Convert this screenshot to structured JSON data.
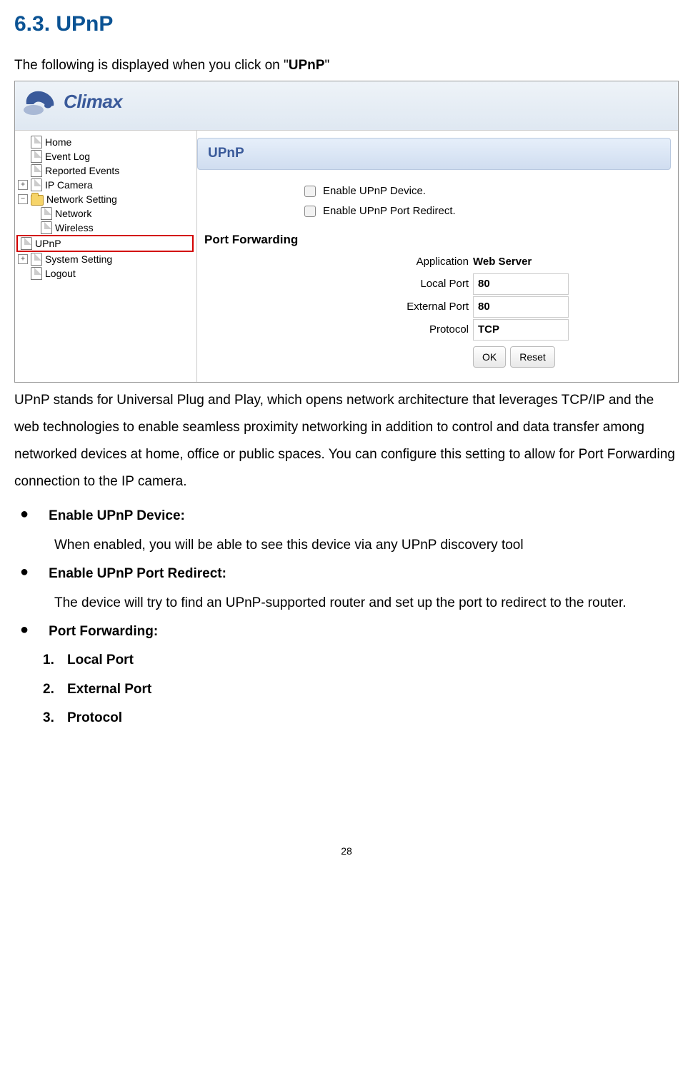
{
  "heading": "6.3. UPnP",
  "intro_prefix": "The following is displayed when you click on \"",
  "intro_bold": "UPnP",
  "intro_suffix": "\"",
  "screenshot": {
    "logo_text": "Climax",
    "tree": {
      "home": "Home",
      "event_log": "Event Log",
      "reported_events": "Reported Events",
      "ip_camera": "IP Camera",
      "network_setting": "Network Setting",
      "network": "Network",
      "wireless": "Wireless",
      "upnp": "UPnP",
      "system_setting": "System Setting",
      "logout": "Logout"
    },
    "panel_title": "UPnP",
    "checkbox1": "Enable UPnP Device.",
    "checkbox2": "Enable UPnP Port Redirect.",
    "port_forwarding_title": "Port Forwarding",
    "application_label": "Application",
    "application_value": "Web Server",
    "local_port_label": "Local Port",
    "local_port_value": "80",
    "external_port_label": "External Port",
    "external_port_value": "80",
    "protocol_label": "Protocol",
    "protocol_value": "TCP",
    "ok_button": "OK",
    "reset_button": "Reset"
  },
  "paragraph": "UPnP stands for Universal Plug and Play, which opens network architecture that leverages TCP/IP and the web technologies to enable seamless proximity networking in addition to control and data transfer among networked devices at home, office or public spaces. You can configure this setting to allow for Port Forwarding connection to the IP camera.",
  "bullets": [
    {
      "title": "Enable UPnP Device:",
      "body": "When enabled, you will be able to see this device via any UPnP discovery tool"
    },
    {
      "title": "Enable UPnP Port Redirect:",
      "body": "The device will try to find an UPnP-supported router and set up the port to redirect to the router."
    },
    {
      "title": "Port Forwarding:",
      "body": ""
    }
  ],
  "numbered": [
    "Local Port",
    "External Port",
    "Protocol"
  ],
  "page_number": "28"
}
